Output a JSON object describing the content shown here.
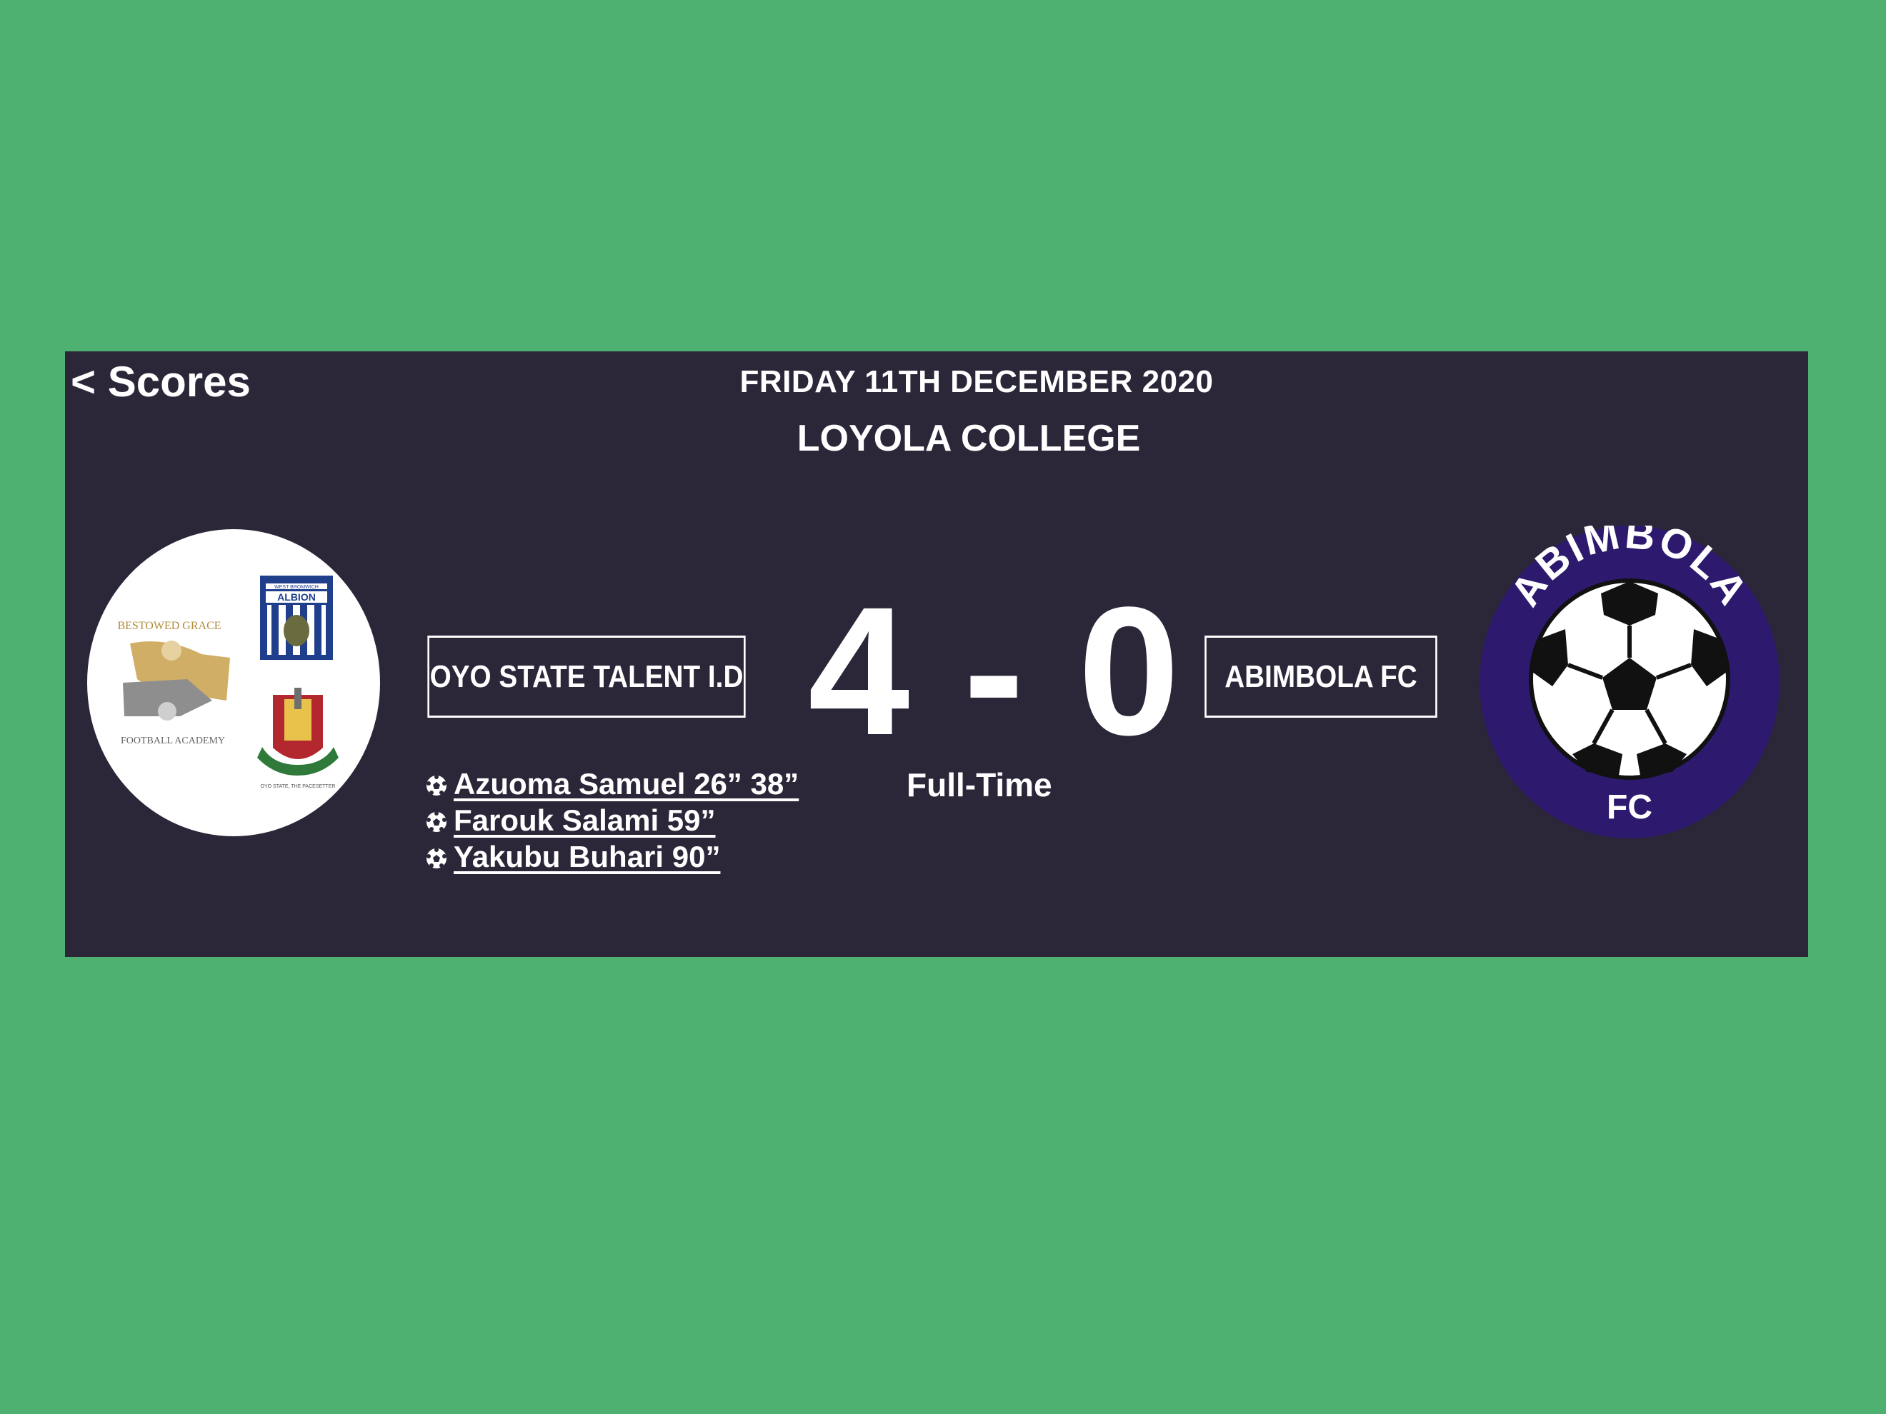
{
  "nav": {
    "back_label": "< Scores"
  },
  "match": {
    "date": "FRIDAY 11TH DECEMBER 2020",
    "venue": "LOYOLA COLLEGE",
    "status": "Full-Time",
    "home_score": "4",
    "separator": "-",
    "away_score": "0"
  },
  "home_team": {
    "name": "OYO STATE TALENT I.D",
    "crest": {
      "academy_logo_text": [
        "BESTOWED GRACE",
        "FOOTBALL ACADEMY"
      ],
      "club_badge_text": [
        "WEST BROMWICH",
        "ALBION"
      ],
      "state_seal_text": "OYO STATE, THE PACESETTER"
    }
  },
  "away_team": {
    "name": "ABIMBOLA FC",
    "crest": {
      "ring_text": "ABIMBOLA",
      "bottom_text": "FC",
      "icon": "soccer-ball-icon"
    }
  },
  "scorers": [
    {
      "icon": "soccer-ball-icon",
      "text": "Azuoma Samuel 26” 38”"
    },
    {
      "icon": "soccer-ball-icon",
      "text": "Farouk Salami 59”"
    },
    {
      "icon": "soccer-ball-icon",
      "text": "Yakubu Buhari 90”"
    }
  ],
  "colors": {
    "background": "#4eb071",
    "panel": "#2c2639",
    "text": "#ffffff",
    "away_crest_ring": "#2d1a6e"
  }
}
